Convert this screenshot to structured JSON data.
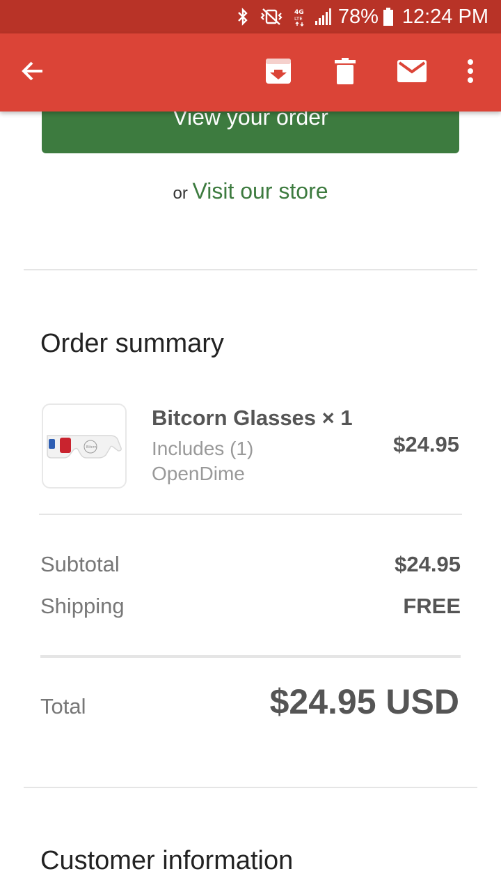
{
  "status_bar": {
    "battery": "78%",
    "time": "12:24 PM",
    "icons": [
      "bluetooth-icon",
      "mute-vibrate-icon",
      "4g-lte-icon",
      "signal-icon",
      "battery-icon"
    ]
  },
  "app_bar": {
    "actions": [
      "back-arrow-icon",
      "archive-icon",
      "delete-icon",
      "mark-unread-icon",
      "more-options-icon"
    ],
    "color": "#db4437"
  },
  "email": {
    "view_order_label": "View your order",
    "or_text": "or",
    "visit_store_label": "Visit our store",
    "order_summary_title": "Order summary",
    "item": {
      "name": "Bitcorn Glasses × 1",
      "includes_line1": "Includes (1)",
      "includes_line2": "OpenDime",
      "price": "$24.95"
    },
    "subtotal_label": "Subtotal",
    "subtotal_value": "$24.95",
    "shipping_label": "Shipping",
    "shipping_value": "FREE",
    "total_label": "Total",
    "total_value": "$24.95 USD",
    "customer_info_title": "Customer information",
    "accent_green": "#3d7b3f"
  }
}
